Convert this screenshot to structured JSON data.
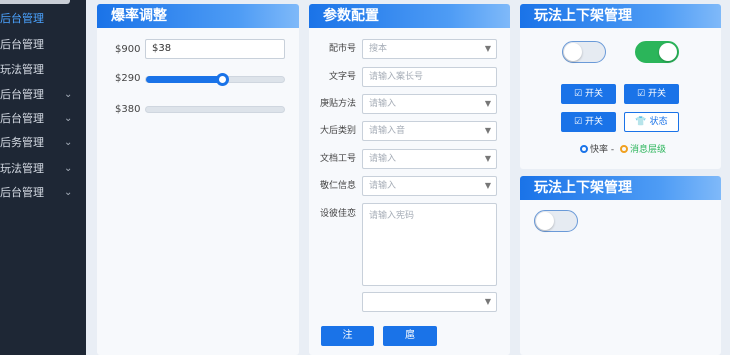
{
  "sidebar": {
    "items": [
      {
        "label": "后台管理",
        "active": true,
        "chevron": false
      },
      {
        "label": "后台管理",
        "active": false,
        "chevron": false
      },
      {
        "label": "玩法管理",
        "active": false,
        "chevron": false
      },
      {
        "label": "后台管理",
        "active": false,
        "chevron": true
      },
      {
        "label": "后台管理",
        "active": false,
        "chevron": true
      },
      {
        "label": "后务管理",
        "active": false,
        "chevron": true
      },
      {
        "label": "玩法管理",
        "active": false,
        "chevron": true
      },
      {
        "label": "后台管理",
        "active": false,
        "chevron": true
      }
    ],
    "chevron_glyph": "⌄"
  },
  "rate_panel": {
    "title": "爆率调整",
    "rows": [
      {
        "label": "$900",
        "input_value": "$38"
      },
      {
        "label": "$290",
        "slider_value": 0.55
      },
      {
        "label": "$380",
        "slider_value": 0
      }
    ]
  },
  "params_panel": {
    "title": "参数配置",
    "fields": [
      {
        "label": "配市号",
        "placeholder": "搜本",
        "type": "select"
      },
      {
        "label": "文字号",
        "placeholder": "请输入案长号",
        "type": "input"
      },
      {
        "label": "庚贴方法",
        "placeholder": "请输入",
        "type": "select"
      },
      {
        "label": "大后类别",
        "placeholder": "请输入音",
        "type": "select"
      },
      {
        "label": "文档工号",
        "placeholder": "请输入",
        "type": "select"
      },
      {
        "label": "敬仁信息",
        "placeholder": "请输入",
        "type": "select"
      }
    ],
    "textarea": {
      "label": "设彼佳恋",
      "placeholder": "请输入宪码"
    },
    "extra_select": {
      "placeholder": ""
    },
    "buttons": [
      {
        "label": "注"
      },
      {
        "label": "扈"
      }
    ]
  },
  "shelf_panel": {
    "title": "玩法上下架管理",
    "toggles": [
      {
        "on": false
      },
      {
        "on": true
      }
    ],
    "buttons": [
      {
        "label": "开关",
        "icon": "checkbox-icon",
        "style": "solid"
      },
      {
        "label": "开关",
        "icon": "checkbox-icon",
        "style": "solid"
      },
      {
        "label": "开关",
        "icon": "checkbox-icon",
        "style": "solid"
      },
      {
        "label": "状态",
        "icon": "shirt-icon",
        "style": "outline"
      }
    ],
    "legend": {
      "item1": "快率 -",
      "item2": "消息层级"
    }
  },
  "shelf_panel_2": {
    "title": "玩法上下架管理",
    "toggles": [
      {
        "on": false
      }
    ]
  },
  "colors": {
    "primary": "#1a73e8",
    "success": "#2bb55a",
    "sidebar_bg": "#1e2735",
    "sidebar_active": "#4ba3ff",
    "legend_orange": "#f0a020"
  }
}
